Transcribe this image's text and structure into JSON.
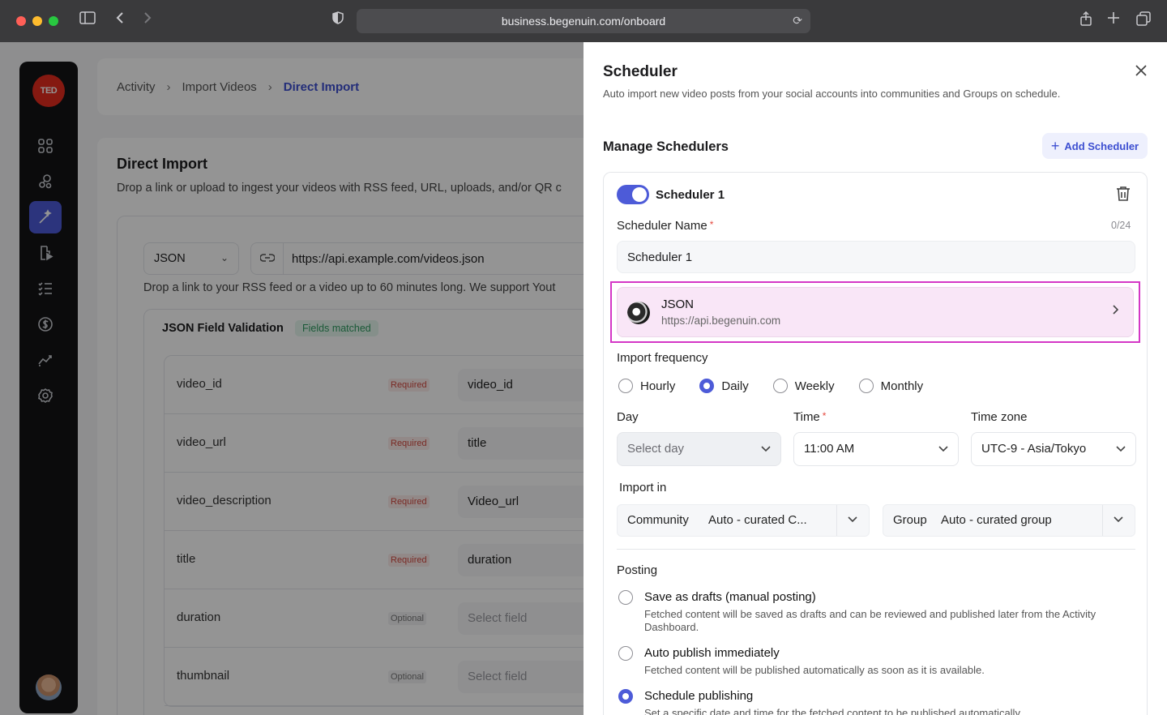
{
  "browser": {
    "url": "business.begenuin.com/onboard",
    "colors": {
      "red": "#ff5f57",
      "yellow": "#febc2e",
      "green": "#28c840"
    }
  },
  "sidebar": {
    "logo": "TED",
    "items": [
      "dashboard-icon",
      "community-icon",
      "magic-wand-icon",
      "video-import-icon",
      "checklist-icon",
      "dollar-icon",
      "analytics-icon",
      "settings-icon"
    ],
    "active_item": "magic-wand-icon"
  },
  "breadcrumb": {
    "items": [
      "Activity",
      "Import Videos",
      "Direct Import"
    ]
  },
  "direct_import": {
    "title": "Direct Import",
    "description": "Drop a link or upload to ingest your videos with RSS feed, URL, uploads, and/or QR c",
    "format": "JSON",
    "url": "https://api.example.com/videos.json",
    "hint": "Drop a link to your RSS feed or a video up to 60 minutes long. We support Yout",
    "validation": {
      "title": "JSON Field Validation",
      "badge": "Fields matched",
      "rows": [
        {
          "field": "video_id",
          "status": "Required",
          "mapped": "video_id",
          "placeholder": false
        },
        {
          "field": "video_url",
          "status": "Required",
          "mapped": "title",
          "placeholder": false
        },
        {
          "field": "video_description",
          "status": "Required",
          "mapped": "Video_url",
          "placeholder": false
        },
        {
          "field": "title",
          "status": "Required",
          "mapped": "duration",
          "placeholder": false
        },
        {
          "field": "duration",
          "status": "Optional",
          "mapped": "Select field",
          "placeholder": true
        },
        {
          "field": "thumbnail",
          "status": "Optional",
          "mapped": "Select field",
          "placeholder": true
        }
      ]
    }
  },
  "scheduler_panel": {
    "title": "Scheduler",
    "subtitle": "Auto import new video posts from your social accounts into communities and Groups on schedule.",
    "manage_title": "Manage Schedulers",
    "add_button": "Add Scheduler",
    "scheduler": {
      "enabled": true,
      "name": "Scheduler 1",
      "name_label": "Scheduler Name",
      "name_count": "0/24",
      "name_value": "Scheduler 1",
      "source": {
        "name": "JSON",
        "url": "https://api.begenuin.com"
      },
      "frequency_label": "Import frequency",
      "frequencies": [
        "Hourly",
        "Daily",
        "Weekly",
        "Monthly"
      ],
      "selected_frequency": "Daily",
      "day_label": "Day",
      "day_placeholder": "Select day",
      "time_label": "Time",
      "time_value": "11:00 AM",
      "timezone_label": "Time zone",
      "timezone_value": "UTC-9 - Asia/Tokyo",
      "import_in_label": "Import in",
      "community_label": "Community",
      "community_value": "Auto - curated C...",
      "group_label": "Group",
      "group_value": "Auto - curated group",
      "posting_label": "Posting",
      "posting_options": [
        {
          "title": "Save as drafts (manual posting)",
          "desc": "Fetched content will be saved as drafts and can be reviewed and published later from the Activity Dashboard."
        },
        {
          "title": "Auto publish immediately",
          "desc": "Fetched content will be published automatically as soon as it is available."
        },
        {
          "title": "Schedule publishing",
          "desc": "Set a specific date and time for the fetched content to be published automatically."
        }
      ],
      "selected_posting": "Schedule publishing"
    }
  },
  "accent_color": "#4d5bd8"
}
